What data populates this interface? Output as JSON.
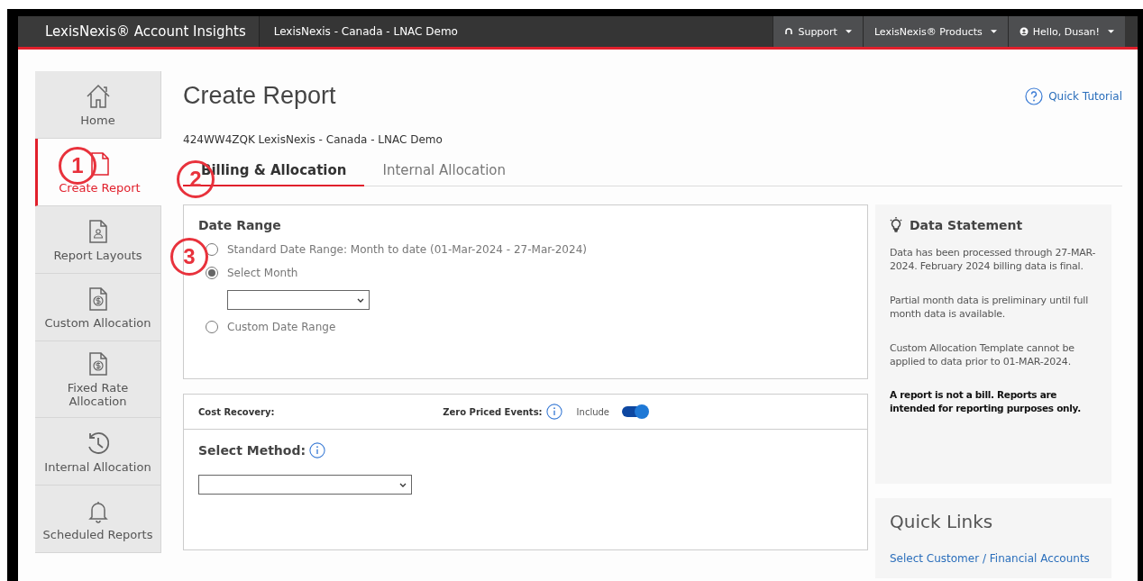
{
  "navbar": {
    "brand": "LexisNexis® Account Insights",
    "account": "LexisNexis - Canada - LNAC Demo",
    "menus": [
      {
        "kind": "support",
        "label": "Support"
      },
      {
        "kind": "products",
        "label": "LexisNexis® Products"
      },
      {
        "kind": "user",
        "label": "Hello, Dusan!"
      }
    ]
  },
  "sidebar": {
    "items": [
      {
        "kind": "home",
        "label": "Home",
        "selected": false
      },
      {
        "kind": "document",
        "label": "Create Report",
        "selected": true
      },
      {
        "kind": "layout",
        "label": "Report Layouts",
        "selected": false
      },
      {
        "kind": "money",
        "label": "Custom Allocation",
        "selected": false
      },
      {
        "kind": "money",
        "label": "Fixed Rate Allocation",
        "selected": false
      },
      {
        "kind": "history",
        "label": "Internal Allocation",
        "selected": false
      },
      {
        "kind": "bell",
        "label": "Scheduled Reports",
        "selected": false
      }
    ]
  },
  "page": {
    "title": "Create Report",
    "tutorial_link": "Quick Tutorial",
    "account_line": "424WW4ZQK LexisNexis - Canada - LNAC Demo"
  },
  "tabs": [
    {
      "label": "Billing & Allocation",
      "selected": true
    },
    {
      "label": "Internal Allocation",
      "selected": false
    }
  ],
  "date_range": {
    "title": "Date Range",
    "options": [
      {
        "label": "Standard Date Range: Month to date (01-Mar-2024 - 27-Mar-2024)",
        "selected": false
      },
      {
        "label": "Select Month",
        "selected": true,
        "has_dropdown": true
      },
      {
        "label": "Custom Date Range",
        "selected": false
      }
    ]
  },
  "cost_recovery": {
    "label": "Cost Recovery:",
    "zero_priced_label": "Zero Priced Events:",
    "toggle_label": "Include",
    "include_on": true,
    "method_label": "Select Method:"
  },
  "data_statement": {
    "title": "Data Statement",
    "paragraphs": [
      {
        "text": "Data has been processed through 27-MAR-2024. February 2024 billing data is final.",
        "bold": false
      },
      {
        "text": "Partial month data is preliminary until full month data is available.",
        "bold": false
      },
      {
        "text": "Custom Allocation Template cannot be applied to data prior to 01-MAR-2024.",
        "bold": false
      },
      {
        "text": "A report is not a bill. Reports are intended for reporting purposes only.",
        "bold": true
      }
    ]
  },
  "quick_links": {
    "title": "Quick Links",
    "links": [
      "Select Customer / Financial Accounts"
    ]
  },
  "callouts": [
    "1",
    "2",
    "3"
  ]
}
